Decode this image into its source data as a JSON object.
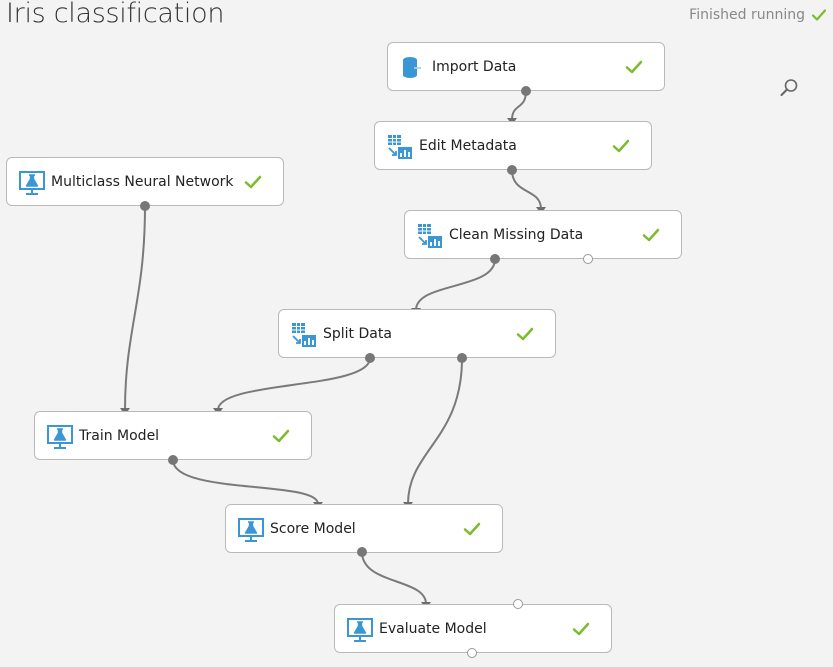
{
  "header": {
    "title": "Iris classification",
    "status_text": "Finished running",
    "status_icon": "check-icon"
  },
  "toolbar": {
    "search_icon": "search-icon"
  },
  "colors": {
    "check": "#7cbb2c",
    "module_icon": "#3a96d4",
    "edge": "#7a7a7a"
  },
  "modules": [
    {
      "name": "import-data",
      "label": "Import Data",
      "icon": "database-import-icon",
      "status": "success"
    },
    {
      "name": "edit-metadata",
      "label": "Edit Metadata",
      "icon": "data-transform-icon",
      "status": "success"
    },
    {
      "name": "multiclass-neural-network",
      "label": "Multiclass Neural Network",
      "icon": "ml-model-icon",
      "status": "success"
    },
    {
      "name": "clean-missing-data",
      "label": "Clean Missing Data",
      "icon": "data-transform-icon",
      "status": "success"
    },
    {
      "name": "split-data",
      "label": "Split Data",
      "icon": "data-transform-icon",
      "status": "success"
    },
    {
      "name": "train-model",
      "label": "Train Model",
      "icon": "ml-model-icon",
      "status": "success"
    },
    {
      "name": "score-model",
      "label": "Score Model",
      "icon": "ml-model-icon",
      "status": "success"
    },
    {
      "name": "evaluate-model",
      "label": "Evaluate Model",
      "icon": "ml-model-icon",
      "status": "success"
    }
  ],
  "connections": [
    {
      "from": "import-data",
      "to": "edit-metadata"
    },
    {
      "from": "edit-metadata",
      "to": "clean-missing-data"
    },
    {
      "from": "clean-missing-data",
      "to": "split-data"
    },
    {
      "from": "multiclass-neural-network",
      "to": "train-model"
    },
    {
      "from": "split-data",
      "to": "train-model"
    },
    {
      "from": "split-data",
      "to": "score-model"
    },
    {
      "from": "train-model",
      "to": "score-model"
    },
    {
      "from": "score-model",
      "to": "evaluate-model"
    }
  ]
}
